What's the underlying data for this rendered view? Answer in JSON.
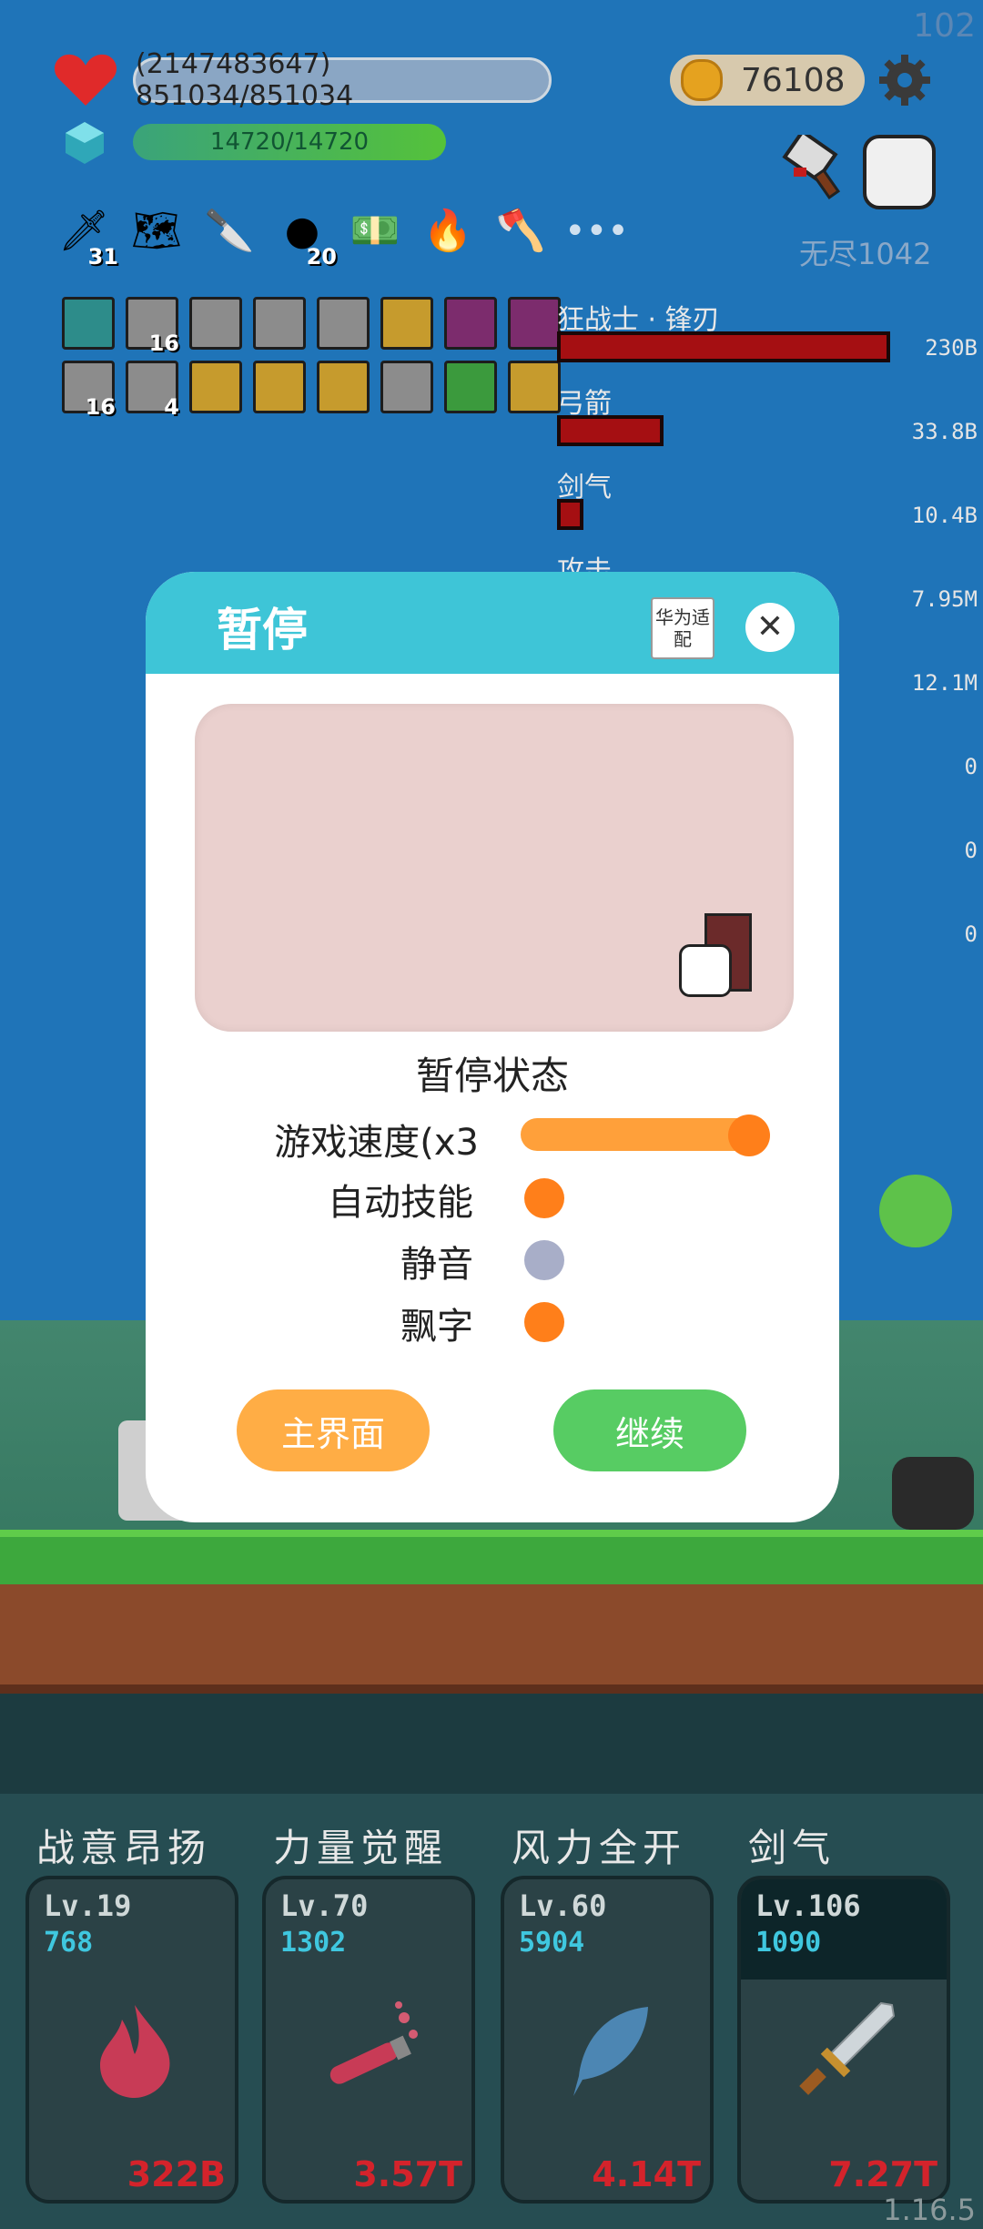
{
  "corner_counter": "102",
  "hp": {
    "text": "(2147483647) 851034/851034"
  },
  "mp": {
    "text": "14720/14720"
  },
  "coins": "76108",
  "endless": "无尽1042",
  "tools": [
    {
      "icon": "sword-icon",
      "count": "31"
    },
    {
      "icon": "map-icon",
      "count": ""
    },
    {
      "icon": "dagger-icon",
      "count": ""
    },
    {
      "icon": "bomb-icon",
      "count": "20"
    },
    {
      "icon": "cash-heart-icon",
      "count": ""
    },
    {
      "icon": "torch-icon",
      "count": ""
    },
    {
      "icon": "axe-icon",
      "count": ""
    }
  ],
  "more": "•••",
  "slots_row1": [
    {
      "style": "teal",
      "count": ""
    },
    {
      "style": "",
      "count": "16"
    },
    {
      "style": "",
      "count": ""
    },
    {
      "style": "",
      "count": ""
    },
    {
      "style": "",
      "count": ""
    },
    {
      "style": "gold",
      "count": ""
    },
    {
      "style": "purple",
      "count": ""
    },
    {
      "style": "purple",
      "count": ""
    }
  ],
  "slots_row2": [
    {
      "style": "",
      "count": "16"
    },
    {
      "style": "",
      "count": "4"
    },
    {
      "style": "gold",
      "count": ""
    },
    {
      "style": "gold",
      "count": ""
    },
    {
      "style": "gold",
      "count": ""
    },
    {
      "style": "",
      "count": ""
    },
    {
      "style": "green",
      "count": ""
    },
    {
      "style": "gold",
      "count": ""
    }
  ],
  "damage": [
    {
      "label": "狂战士 · 锋刃",
      "value": "230B",
      "share": 1.0
    },
    {
      "label": "弓箭",
      "value": "33.8B",
      "share": 0.32
    },
    {
      "label": "剑气",
      "value": "10.4B",
      "share": 0.08
    },
    {
      "label": "攻击",
      "value": "7.95M",
      "share": 0.0
    }
  ],
  "side_values": [
    "12.1M",
    "0",
    "0",
    "0"
  ],
  "modal": {
    "title": "暂停",
    "huawei_btn": "华为适配",
    "close": "✕",
    "state_title": "暂停状态",
    "speed_label": "游戏速度(x3",
    "speed_level": 1.0,
    "auto_skill_label": "自动技能",
    "mute_label": "静音",
    "float_text_label": "飘字",
    "auto_skill_on": true,
    "mute_on": false,
    "float_text_on": true,
    "home_btn": "主界面",
    "continue_btn": "继续"
  },
  "skills": [
    {
      "title": "战意昂扬",
      "lv": "Lv.19",
      "cost": "768",
      "dmg": "322B",
      "icon": "flame-icon"
    },
    {
      "title": "力量觉醒",
      "lv": "Lv.70",
      "cost": "1302",
      "dmg": "3.57T",
      "icon": "potion-icon"
    },
    {
      "title": "风力全开",
      "lv": "Lv.60",
      "cost": "5904",
      "dmg": "4.14T",
      "icon": "feather-icon"
    },
    {
      "title": "剑气",
      "lv": "Lv.106",
      "cost": "1090",
      "dmg": "7.27T",
      "icon": "sword-icon"
    }
  ],
  "version": "1.16.5",
  "colors": {
    "modal_header": "#3ec5d7",
    "orange": "#ff7f1a",
    "green_btn": "#57cc63",
    "damage_red": "#a50f12"
  }
}
